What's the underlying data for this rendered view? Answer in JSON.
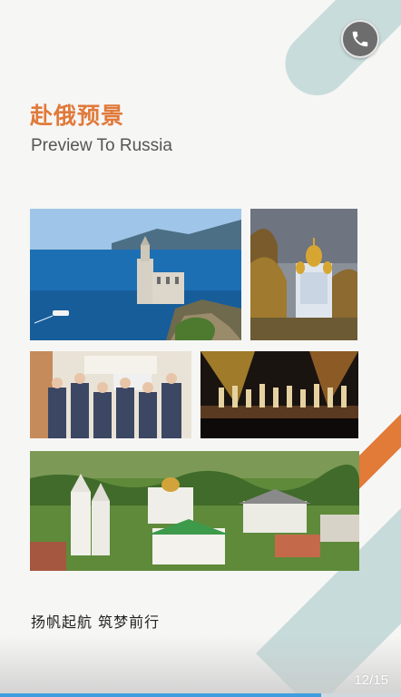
{
  "header": {
    "title_cn": "赴俄预景",
    "title_en": "Preview To Russia"
  },
  "controls": {
    "call_icon": "phone-icon"
  },
  "photos": [
    {
      "subject": "Swallow's Nest castle on cliff by the sea"
    },
    {
      "subject": "Church with golden domes among autumn trees"
    },
    {
      "subject": "Group of students in uniforms holding a sign"
    },
    {
      "subject": "Performers on a stage with lights"
    },
    {
      "subject": "Old town with white churches and green roofs"
    }
  ],
  "slogan": "扬帆起航  筑梦前行",
  "pagination": {
    "text": "12/15",
    "progress": 0.8
  },
  "colors": {
    "accent": "#e07a3a",
    "stripe": "#c9dcdc",
    "progress": "#3f9ee0"
  }
}
